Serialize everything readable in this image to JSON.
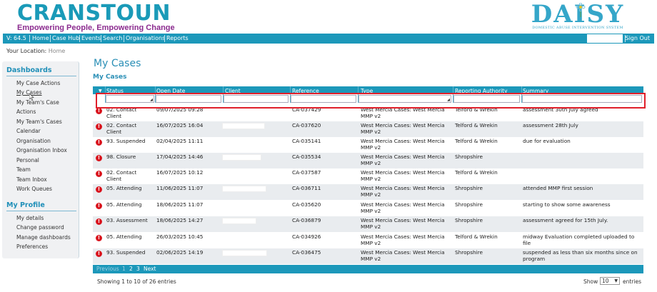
{
  "header": {
    "brand": "CRANSTOUN",
    "tagline": "Empowering People, Empowering Change",
    "logo_word": "DAISY",
    "logo_sub": "DOMESTIC ABUSE INTERVENTION SYSTEM"
  },
  "nav": {
    "version": "V: 64.5",
    "items": [
      "Home",
      "Case Hub",
      "Events",
      "Search",
      "Organisations",
      "Reports"
    ],
    "sign_out": "Sign Out"
  },
  "location": {
    "label": "Your Location:",
    "value": "Home"
  },
  "sidebar": {
    "dashboards_title": "Dashboards",
    "dashboards": [
      "My Case Actions",
      "My Cases",
      "My Team's Case",
      "Actions",
      "My Team's Cases",
      "Calendar",
      "Organisation",
      "Organisation Inbox",
      "Personal",
      "Team",
      "Team Inbox",
      "Work Queues"
    ],
    "profile_title": "My Profile",
    "profile": [
      "My details",
      "Change password",
      "Manage dashboards",
      "Preferences"
    ]
  },
  "main": {
    "title": "My Cases",
    "subtitle": "My Cases"
  },
  "table": {
    "columns": [
      "Status",
      "Open Date",
      "Client",
      "Reference",
      "Type",
      "Reporting Authority",
      "Summary"
    ],
    "rows": [
      {
        "status": [
          "02. Contact",
          "Client"
        ],
        "date": "09/07/2025 09:28",
        "ref": "CA-037429",
        "type": [
          "West Mercia Cases: West Mercia",
          "MMP v2"
        ],
        "authority": "Telford & Wrekin",
        "summary": [
          "assessment 30th July agreed"
        ]
      },
      {
        "status": [
          "02. Contact",
          "Client"
        ],
        "date": "16/07/2025 16:04",
        "ref": "CA-037620",
        "type": [
          "West Mercia Cases: West Mercia",
          "MMP v2"
        ],
        "authority": "Telford & Wrekin",
        "summary": [
          "assessment 28th July"
        ]
      },
      {
        "status": [
          "93. Suspended"
        ],
        "date": "02/04/2025 11:11",
        "ref": "CA-035141",
        "type": [
          "West Mercia Cases: West Mercia",
          "MMP v2"
        ],
        "authority": "Telford & Wrekin",
        "summary": [
          "due for evaluation"
        ]
      },
      {
        "status": [
          "98. Closure"
        ],
        "date": "17/04/2025 14:46",
        "ref": "CA-035534",
        "type": [
          "West Mercia Cases: West Mercia",
          "MMP v2"
        ],
        "authority": "Shropshire",
        "summary": [
          ""
        ]
      },
      {
        "status": [
          "02. Contact",
          "Client"
        ],
        "date": "16/07/2025 10:12",
        "ref": "CA-037587",
        "type": [
          "West Mercia Cases: West Mercia",
          "MMP v2"
        ],
        "authority": "Telford & Wrekin",
        "summary": [
          ""
        ]
      },
      {
        "status": [
          "05. Attending"
        ],
        "date": "11/06/2025 11:07",
        "ref": "CA-036711",
        "type": [
          "West Mercia Cases: West Mercia",
          "MMP v2"
        ],
        "authority": "Shropshire",
        "summary": [
          "attended MMP first session"
        ]
      },
      {
        "status": [
          "05. Attending"
        ],
        "date": "18/06/2025 11:07",
        "ref": "CA-035620",
        "type": [
          "West Mercia Cases: West Mercia",
          "MMP v2"
        ],
        "authority": "Shropshire",
        "summary": [
          "starting to show some awareness"
        ]
      },
      {
        "status": [
          "03. Assessment"
        ],
        "date": "18/06/2025 14:27",
        "ref": "CA-036879",
        "type": [
          "West Mercia Cases: West Mercia",
          "MMP v2"
        ],
        "authority": "Shropshire",
        "summary": [
          "assessment agreed for 15th July."
        ]
      },
      {
        "status": [
          "05. Attending"
        ],
        "date": "26/03/2025 10:45",
        "ref": "CA-034926",
        "type": [
          "West Mercia Cases: West Mercia",
          "MMP v2"
        ],
        "authority": "Telford & Wrekin",
        "summary": [
          "midway Evaluation completed uploaded to file"
        ]
      },
      {
        "status": [
          "93. Suspended"
        ],
        "date": "02/06/2025 14:19",
        "ref": "CA-036475",
        "type": [
          "West Mercia Cases: West Mercia",
          "MMP v2"
        ],
        "authority": "Shropshire",
        "summary": [
          "suspended as less than six months since on",
          "program"
        ]
      }
    ]
  },
  "pager": {
    "previous": "Previous",
    "pages": [
      "1",
      "2",
      "3"
    ],
    "next": "Next"
  },
  "footer": {
    "info": "Showing 1 to 10 of 26 entries",
    "show": "Show",
    "page_size": "10",
    "entries": "entries"
  }
}
